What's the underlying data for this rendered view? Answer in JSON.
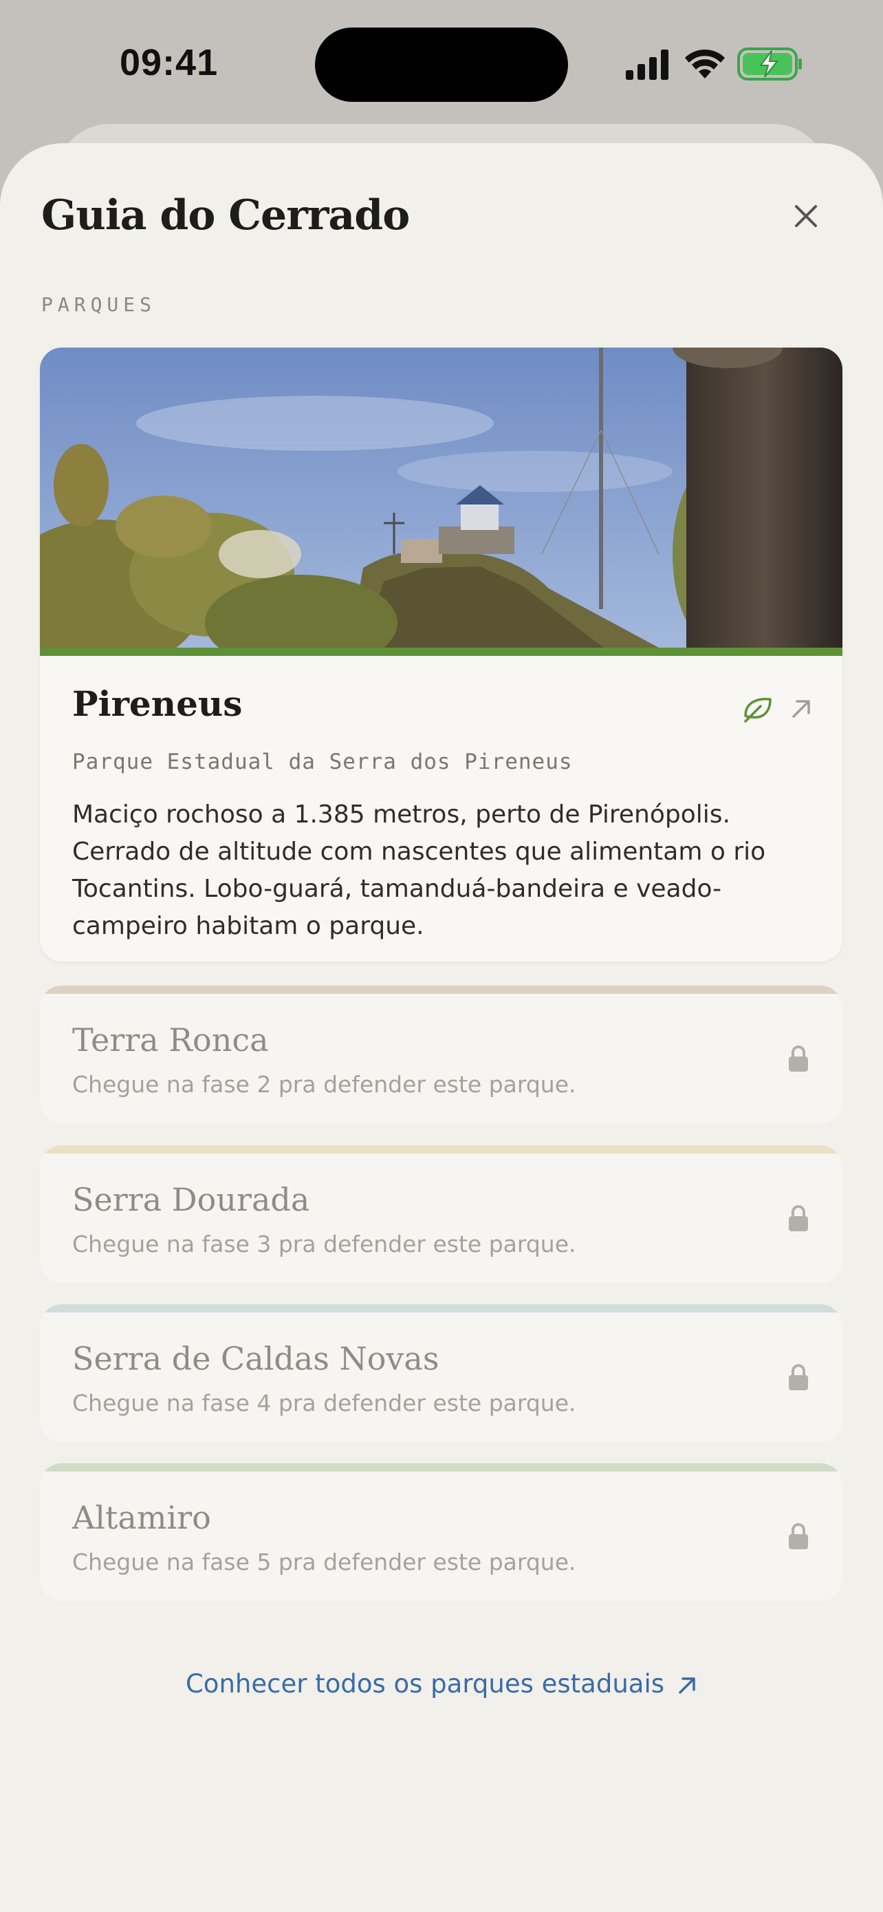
{
  "status_bar": {
    "time": "09:41"
  },
  "sheet": {
    "title": "Guia do Cerrado",
    "section_label": "PARQUES"
  },
  "featured_park": {
    "name": "Pireneus",
    "subtitle": "Parque Estadual da Serra dos Pireneus",
    "description": "Maciço rochoso a 1.385 metros, perto de Pirenópolis. Cerrado de altitude com nascentes que alimentam o rio Tocantins. Lobo-guará, tamanduá-bandeira e veado-campeiro habitam o parque.",
    "accent_color": "#5f9236",
    "icons": [
      "leaf-icon",
      "arrow-up-right-icon"
    ]
  },
  "locked_parks": [
    {
      "name": "Terra Ronca",
      "hint": "Chegue na fase 2 pra defender este parque.",
      "accent_color": "#ddd2c1"
    },
    {
      "name": "Serra Dourada",
      "hint": "Chegue na fase 3 pra defender este parque.",
      "accent_color": "#ece0c4"
    },
    {
      "name": "Serra de Caldas Novas",
      "hint": "Chegue na fase 4 pra defender este parque.",
      "accent_color": "#cfdedb"
    },
    {
      "name": "Altamiro",
      "hint": "Chegue na fase 5 pra defender este parque.",
      "accent_color": "#cfdcc6"
    }
  ],
  "footer_link": {
    "label": "Conhecer todos os parques estaduais",
    "color": "#3a6ba8"
  }
}
